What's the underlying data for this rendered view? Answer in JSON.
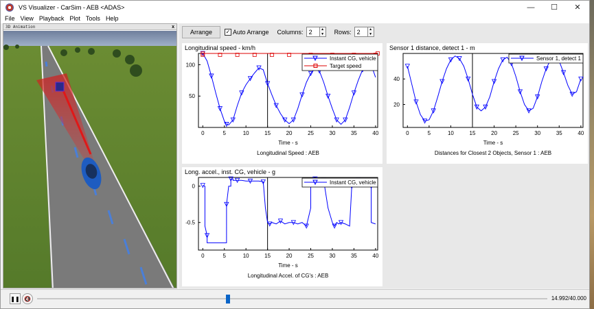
{
  "window": {
    "title": "VS Visualizer - CarSim - AEB <ADAS>",
    "minimize": "—",
    "maximize": "☐",
    "close": "✕"
  },
  "menu": [
    "File",
    "View",
    "Playback",
    "Plot",
    "Tools",
    "Help"
  ],
  "animation": {
    "title": "3D Animation",
    "close": "x"
  },
  "toolbar": {
    "arrange_label": "Arrange",
    "auto_arrange_label": "Auto Arrange",
    "auto_arrange_checked": true,
    "columns_label": "Columns:",
    "columns_value": "2",
    "rows_label": "Rows:",
    "rows_value": "2"
  },
  "plots": [
    {
      "id": "speed",
      "title": "Longitudinal speed - km/h",
      "xlabel": "Time - s",
      "caption": "Longitudinal Speed : AEB",
      "legend": [
        "Instant CG, vehicle",
        "Target speed"
      ]
    },
    {
      "id": "distance",
      "title": "Sensor 1 distance, detect 1 - m",
      "xlabel": "Time - s",
      "caption": "Distances for Closest 2 Objects, Sensor 1 : AEB",
      "legend": [
        "Sensor 1, detect 1"
      ]
    },
    {
      "id": "accel",
      "title": "Long. accel., inst. CG, vehicle - g",
      "xlabel": "Time - s",
      "caption": "Longitudinal Accel. of CG's : AEB",
      "legend": [
        "Instant CG, vehicle"
      ]
    }
  ],
  "chart_data": [
    {
      "type": "line",
      "x_ticks": [
        0,
        5,
        10,
        15,
        20,
        25,
        30,
        35,
        40
      ],
      "y_ticks": [
        50,
        100
      ],
      "xlim": [
        -1,
        40.5
      ],
      "ylim": [
        0,
        118
      ],
      "cursor_x": 15,
      "series": [
        {
          "name": "Instant CG, vehicle",
          "color": "#0000ff",
          "x": [
            0,
            1,
            2,
            3,
            4,
            5,
            5.5,
            6,
            7,
            8,
            9,
            10,
            11,
            12,
            13,
            14,
            15,
            16,
            17,
            18,
            19,
            20,
            21,
            22,
            23,
            24,
            25,
            26,
            27,
            28,
            29,
            30,
            31,
            32,
            33,
            34,
            35,
            36,
            37,
            38,
            39,
            40
          ],
          "y": [
            118,
            106,
            82,
            55,
            30,
            10,
            5,
            4,
            12,
            35,
            55,
            68,
            78,
            87,
            95,
            92,
            70,
            52,
            35,
            22,
            12,
            6,
            12,
            30,
            52,
            72,
            86,
            94,
            90,
            72,
            50,
            30,
            12,
            5,
            12,
            32,
            55,
            75,
            92,
            102,
            100,
            80
          ]
        },
        {
          "name": "Target speed",
          "color": "#dd0000",
          "x": [
            0,
            40.5
          ],
          "y": [
            119,
            119
          ]
        }
      ]
    },
    {
      "type": "line",
      "x_ticks": [
        0,
        5,
        10,
        15,
        20,
        25,
        30,
        35,
        40
      ],
      "y_ticks": [
        20,
        40
      ],
      "xlim": [
        -1,
        40.5
      ],
      "ylim": [
        2,
        60
      ],
      "cursor_x": 15,
      "series": [
        {
          "name": "Sensor 1, detect 1",
          "color": "#0000ff",
          "x": [
            0,
            1,
            2,
            3,
            4,
            5,
            6,
            7,
            8,
            9,
            10,
            11,
            12,
            13,
            14,
            15,
            16,
            17,
            18,
            19,
            20,
            21,
            22,
            23,
            24,
            25,
            26,
            27,
            28,
            29,
            30,
            31,
            32,
            33,
            34,
            35,
            36,
            37,
            38,
            39,
            40
          ],
          "y": [
            50,
            36,
            22,
            12,
            7,
            8,
            15,
            26,
            38,
            48,
            55,
            58,
            56,
            50,
            40,
            28,
            18,
            15,
            18,
            26,
            38,
            48,
            55,
            57,
            52,
            42,
            30,
            20,
            15,
            17,
            26,
            38,
            48,
            55,
            57,
            54,
            45,
            35,
            28,
            30,
            40
          ]
        }
      ]
    },
    {
      "type": "line",
      "x_ticks": [
        0,
        5,
        10,
        15,
        20,
        25,
        30,
        35,
        40
      ],
      "y_ticks": [
        -0.5,
        0
      ],
      "xlim": [
        -1,
        40.5
      ],
      "ylim": [
        -0.88,
        0.12
      ],
      "cursor_x": 15,
      "series": [
        {
          "name": "Instant CG, vehicle",
          "color": "#0000ff",
          "x": [
            0,
            0.5,
            0.5,
            1,
            1,
            5.5,
            5.5,
            6,
            6.5,
            6.5,
            7,
            7,
            8,
            9,
            10,
            11,
            12,
            13,
            14,
            14.5,
            15,
            15.5,
            16,
            17,
            18,
            19,
            20,
            21,
            22,
            23,
            24,
            25,
            25,
            26,
            26.5,
            27,
            28,
            29,
            30,
            30.5,
            31,
            31.5,
            32,
            33,
            34,
            34.5,
            35,
            35.5,
            36,
            37,
            38,
            39,
            39,
            40
          ],
          "y": [
            0.01,
            0.0,
            -0.55,
            -0.68,
            -0.78,
            -0.78,
            -0.25,
            0.0,
            0.0,
            0.1,
            0.1,
            0.08,
            0.08,
            0.08,
            0.07,
            0.07,
            0.07,
            0.07,
            0.06,
            -0.3,
            -0.5,
            -0.52,
            -0.5,
            -0.52,
            -0.48,
            -0.52,
            -0.5,
            -0.5,
            -0.52,
            -0.5,
            -0.55,
            -0.3,
            0.1,
            0.1,
            0.1,
            0.1,
            0.08,
            -0.3,
            -0.5,
            -0.55,
            -0.5,
            -0.52,
            -0.5,
            -0.52,
            -0.55,
            0.0,
            0.1,
            0.1,
            0.08,
            0.08,
            0.05,
            0.0,
            -0.5,
            -0.52
          ]
        }
      ]
    }
  ],
  "transport": {
    "pause_icon": "pause-icon",
    "mute_icon": "mute-icon",
    "progress_fraction": 0.3748,
    "time_text": "14.992/40.000"
  }
}
